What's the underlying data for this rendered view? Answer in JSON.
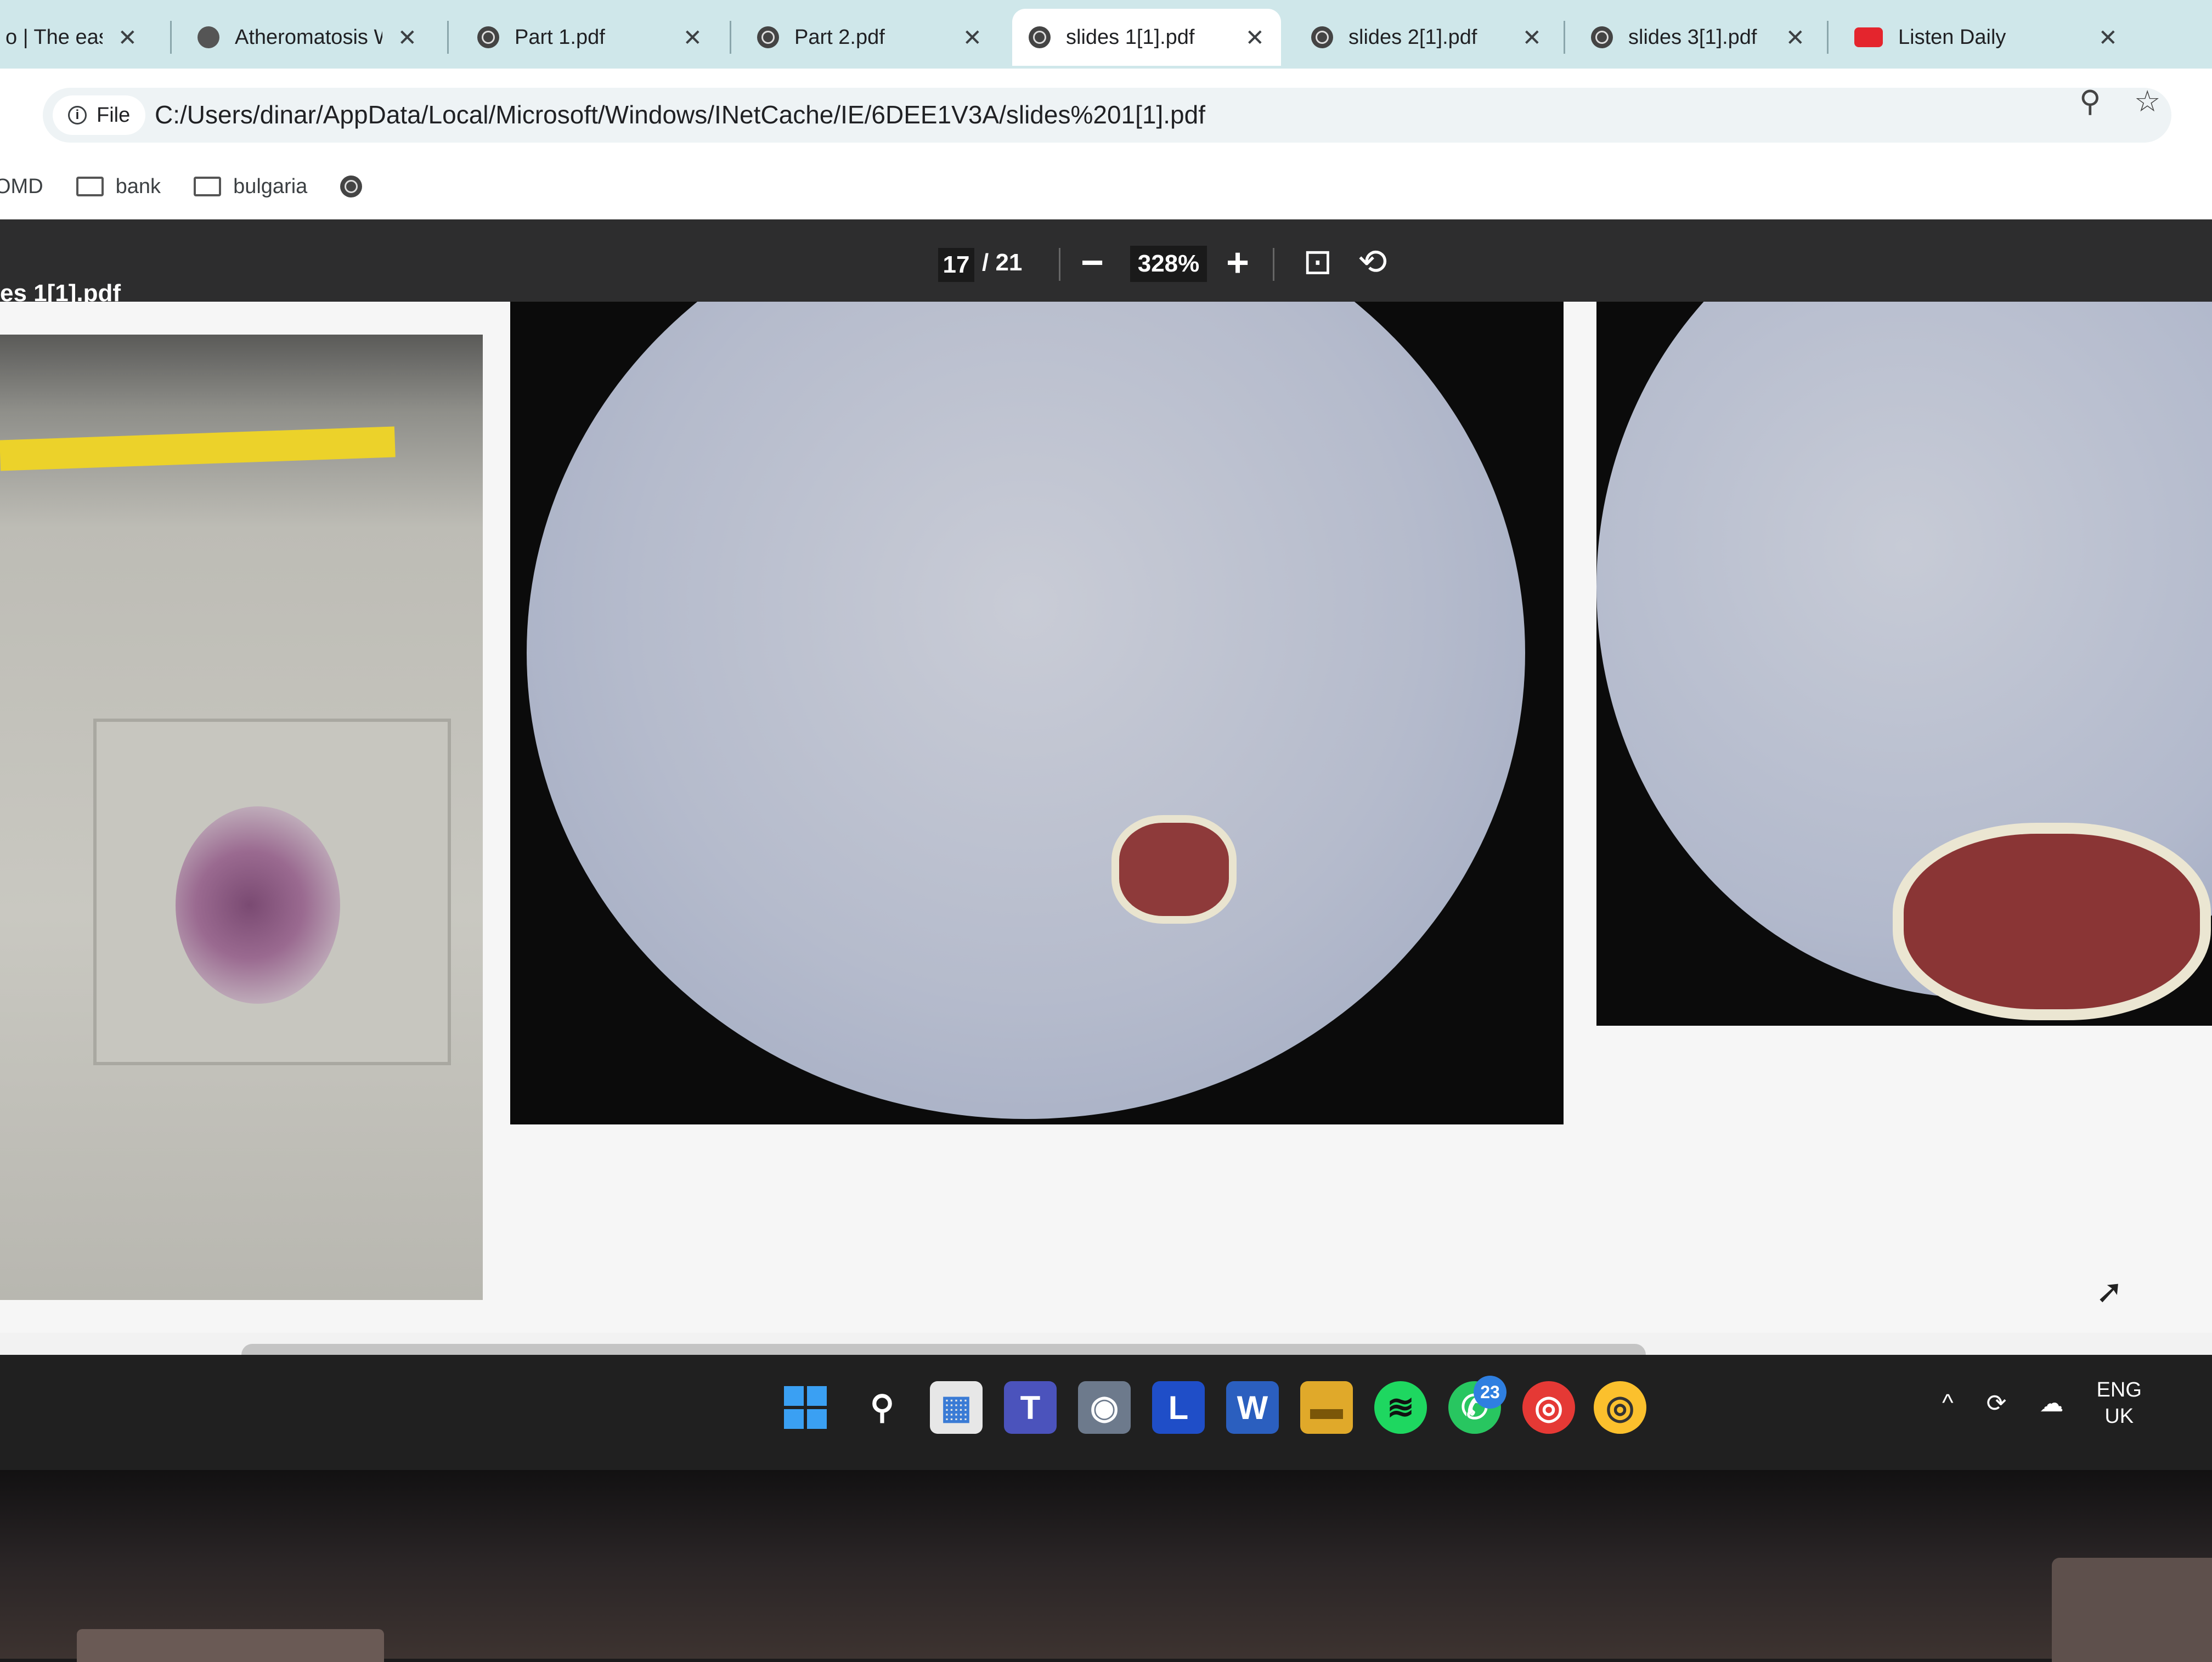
{
  "browser": {
    "tabs": [
      {
        "label": "o | The easi",
        "icon": "globe-icon"
      },
      {
        "label": "Atheromatosis W",
        "icon": "chatgpt-icon"
      },
      {
        "label": "Part 1.pdf",
        "icon": "globe-icon"
      },
      {
        "label": "Part 2.pdf",
        "icon": "globe-icon"
      },
      {
        "label": "slides 1[1].pdf",
        "icon": "globe-icon",
        "active": true
      },
      {
        "label": "slides 2[1].pdf",
        "icon": "globe-icon"
      },
      {
        "label": "slides 3[1].pdf",
        "icon": "globe-icon"
      },
      {
        "label": "Listen Daily",
        "icon": "youtube-icon"
      }
    ],
    "close_glyph": "✕",
    "site_chip": "File",
    "url": "C:/Users/dinar/AppData/Local/Microsoft/Windows/INetCache/IE/6DEE1V3A/slides%201[1].pdf",
    "bookmarks": [
      {
        "label": "OMD",
        "icon": "none"
      },
      {
        "label": "bank",
        "icon": "folder-icon"
      },
      {
        "label": "bulgaria",
        "icon": "folder-icon"
      }
    ]
  },
  "pdf": {
    "doc_title": "es 1[1].pdf",
    "page_current": "17",
    "page_total": "/ 21",
    "zoom": "328%",
    "zoom_out": "−",
    "zoom_in": "+",
    "fit_icon": "⊡",
    "rotate_icon": "⟲"
  },
  "taskbar": {
    "apps": [
      {
        "name": "start-button",
        "label": ""
      },
      {
        "name": "search-icon",
        "label": "⚲"
      },
      {
        "name": "store-icon",
        "label": "▦"
      },
      {
        "name": "teams-icon",
        "label": "T"
      },
      {
        "name": "camera-icon",
        "label": "◉"
      },
      {
        "name": "lexicon-icon",
        "label": "L"
      },
      {
        "name": "word-icon",
        "label": "W"
      },
      {
        "name": "file-explorer-icon",
        "label": "▬"
      },
      {
        "name": "spotify-icon",
        "label": "≋"
      },
      {
        "name": "whatsapp-icon",
        "label": "✆"
      },
      {
        "name": "chrome-icon",
        "label": "◎"
      },
      {
        "name": "chrome-profile-icon",
        "label": "◎"
      }
    ],
    "whatsapp_badge": "23",
    "tray_chevron": "^",
    "lang_line1": "ENG",
    "lang_line2": "UK"
  },
  "colors": {
    "tabbar": "#cfe7ea",
    "pdf_toolbar": "#2d2d2e",
    "taskbar": "#202020",
    "accent_blue": "#3aa0f3"
  }
}
